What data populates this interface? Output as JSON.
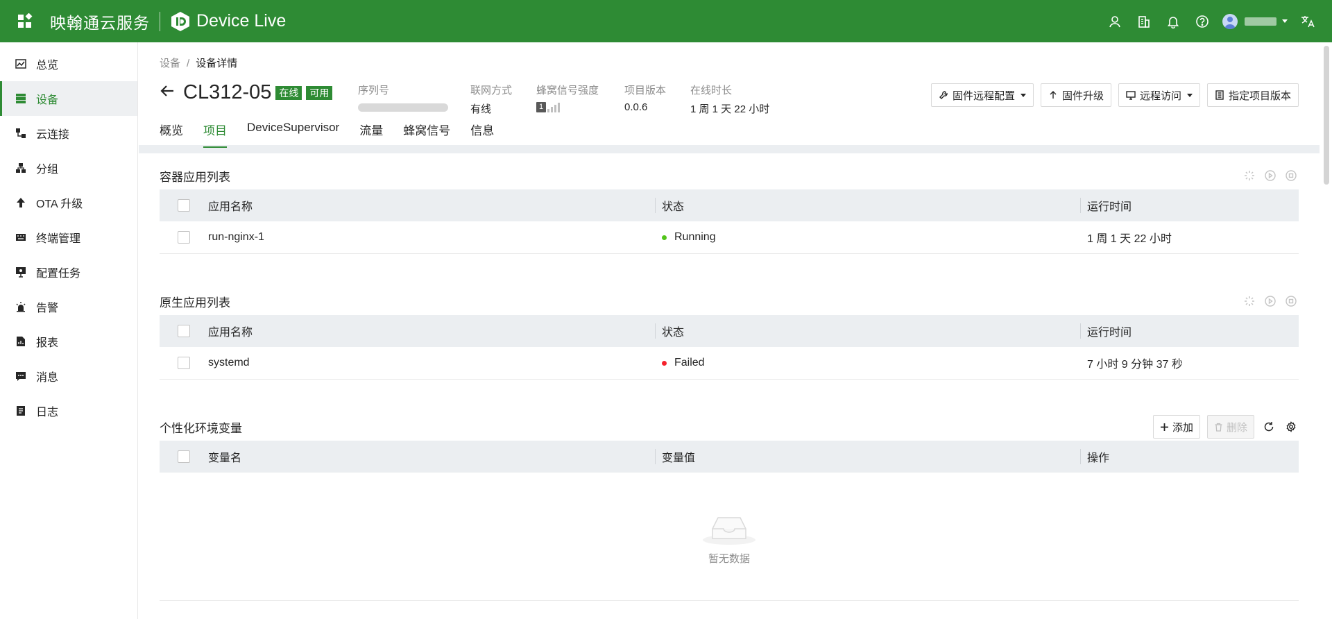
{
  "topbar": {
    "brand": "映翰通云服务",
    "product": "Device Live",
    "icons": [
      "user-group-icon",
      "building-icon",
      "bell-icon",
      "help-icon",
      "translate-icon"
    ],
    "colors": {
      "brand_green": "#2e8b34"
    }
  },
  "sidebar": {
    "items": [
      {
        "label": "总览",
        "icon": "dashboard-icon"
      },
      {
        "label": "设备",
        "icon": "device-icon",
        "active": true
      },
      {
        "label": "云连接",
        "icon": "cloud-connect-icon"
      },
      {
        "label": "分组",
        "icon": "group-icon"
      },
      {
        "label": "OTA 升级",
        "icon": "upload-icon"
      },
      {
        "label": "终端管理",
        "icon": "keyboard-icon"
      },
      {
        "label": "配置任务",
        "icon": "monitor-config-icon"
      },
      {
        "label": "告警",
        "icon": "alarm-icon"
      },
      {
        "label": "报表",
        "icon": "report-icon"
      },
      {
        "label": "消息",
        "icon": "message-icon"
      },
      {
        "label": "日志",
        "icon": "log-icon"
      }
    ]
  },
  "breadcrumb": {
    "parent": "设备",
    "sep": "/",
    "current": "设备详情"
  },
  "device": {
    "name": "CL312-05",
    "status_tag": "在线",
    "avail_tag": "可用",
    "meta": {
      "serial_label": "序列号",
      "network_label": "联网方式",
      "network_value": "有线",
      "signal_label": "蜂窝信号强度",
      "signal_value": "1",
      "version_label": "项目版本",
      "version_value": "0.0.6",
      "uptime_label": "在线时长",
      "uptime_value": "1 周 1 天 22 小时"
    }
  },
  "actions": {
    "firmware_config": "固件远程配置",
    "firmware_upgrade": "固件升级",
    "remote_access": "远程访问",
    "assign_version": "指定项目版本"
  },
  "tabs": [
    "概览",
    "项目",
    "DeviceSupervisor",
    "流量",
    "蜂窝信号",
    "信息"
  ],
  "container_apps": {
    "title": "容器应用列表",
    "columns": [
      "应用名称",
      "状态",
      "运行时间"
    ],
    "rows": [
      {
        "name": "run-nginx-1",
        "status": "Running",
        "status_color": "#52c41a",
        "uptime": "1 周 1 天 22 小时"
      }
    ]
  },
  "native_apps": {
    "title": "原生应用列表",
    "columns": [
      "应用名称",
      "状态",
      "运行时间"
    ],
    "rows": [
      {
        "name": "systemd",
        "status": "Failed",
        "status_color": "#f5222d",
        "uptime": "7 小时 9 分钟 37 秒"
      }
    ]
  },
  "env_vars": {
    "title": "个性化环境变量",
    "add_label": "添加",
    "delete_label": "删除",
    "columns": [
      "变量名",
      "变量值",
      "操作"
    ],
    "empty_text": "暂无数据"
  }
}
